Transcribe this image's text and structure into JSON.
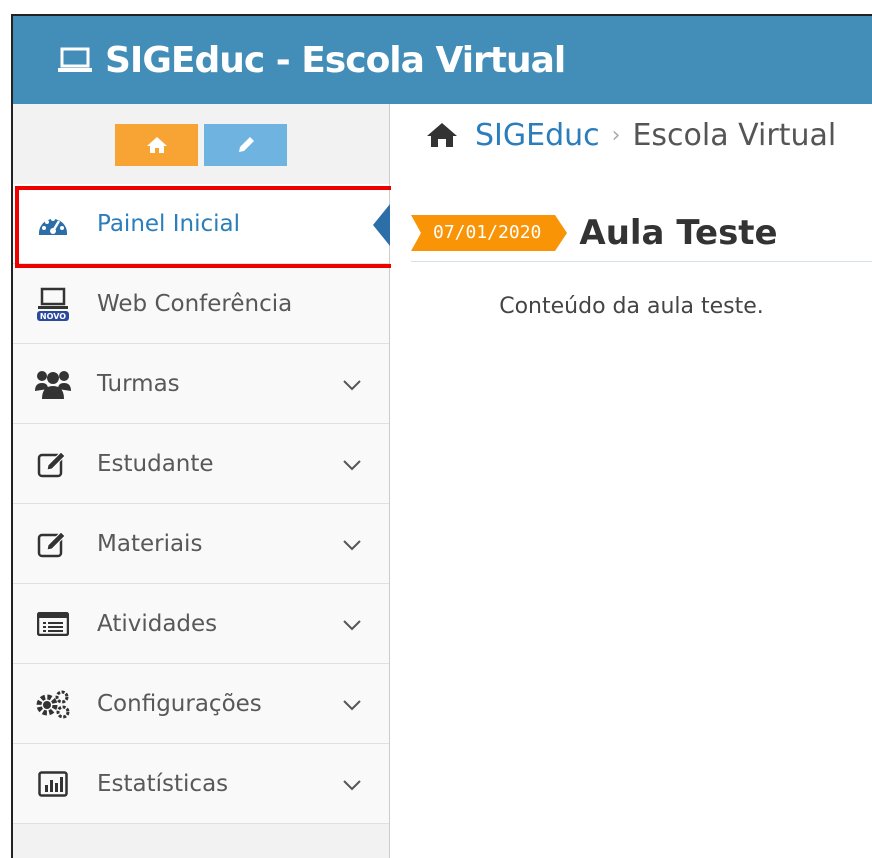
{
  "header": {
    "app_title": "SIGEduc - Escola Virtual",
    "logo_icon": "laptop-icon",
    "background_color": "#438eb9"
  },
  "sidebar": {
    "shortcuts": [
      {
        "icon": "home-icon",
        "color": "#f7a435"
      },
      {
        "icon": "pencil-icon",
        "color": "#6fb3e0"
      }
    ],
    "items": [
      {
        "label": "Painel Inicial",
        "icon": "dashboard-icon",
        "active": true
      },
      {
        "label": "Web Conferência",
        "icon": "laptop-novo-icon",
        "badge": "NOVO"
      },
      {
        "label": "Turmas",
        "icon": "users-icon"
      },
      {
        "label": "Estudante",
        "icon": "edit-icon"
      },
      {
        "label": "Materiais",
        "icon": "edit-icon"
      },
      {
        "label": "Atividades",
        "icon": "list-icon"
      },
      {
        "label": "Configurações",
        "icon": "cogs-icon"
      },
      {
        "label": "Estatísticas",
        "icon": "bar-chart-icon"
      }
    ]
  },
  "breadcrumb": {
    "home": "SIGEduc",
    "separator": "›",
    "current": "Escola Virtual"
  },
  "lesson": {
    "date": "07/01/2020",
    "title": "Aula Teste",
    "content": "Conteúdo da aula teste."
  },
  "colors": {
    "accent": "#2b7dbc",
    "date_tag": "#f89406",
    "highlight": "#ee0000"
  }
}
